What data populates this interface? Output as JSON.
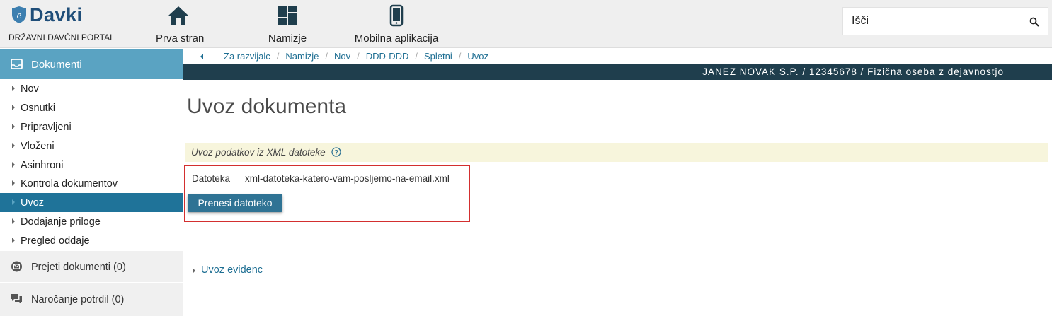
{
  "header": {
    "logo_text": "Davki",
    "logo_subtitle": "DRŽAVNI DAVČNI PORTAL",
    "nav": [
      {
        "label": "Prva stran",
        "icon": "home-icon"
      },
      {
        "label": "Namizje",
        "icon": "dashboard-icon"
      },
      {
        "label": "Mobilna aplikacija",
        "icon": "mobile-phone-icon"
      }
    ],
    "search": {
      "value": "Išči",
      "icon": "search-icon"
    }
  },
  "sidebar": {
    "section_title": "Dokumenti",
    "items": [
      {
        "label": "Nov",
        "active": false
      },
      {
        "label": "Osnutki",
        "active": false
      },
      {
        "label": "Pripravljeni",
        "active": false
      },
      {
        "label": "Vloženi",
        "active": false
      },
      {
        "label": "Asinhroni",
        "active": false
      },
      {
        "label": "Kontrola dokumentov",
        "active": false
      },
      {
        "label": "Uvoz",
        "active": true
      },
      {
        "label": "Dodajanje priloge",
        "active": false
      },
      {
        "label": "Pregled oddaje",
        "active": false
      }
    ],
    "received": "Prejeti dokumenti (0)",
    "orders": "Naročanje potrdil (0)"
  },
  "breadcrumb": [
    "Za razvijalc",
    "Namizje",
    "Nov",
    "DDD-DDD",
    "Spletni",
    "Uvoz"
  ],
  "userbar": "JANEZ NOVAK S.P. / 12345678 / Fizična oseba z dejavnostjo",
  "main": {
    "title": "Uvoz dokumenta",
    "info": "Uvoz podatkov iz XML datoteke",
    "file_label": "Datoteka",
    "file_name": "xml-datoteka-katero-vam-posljemo-na-email.xml",
    "upload_button": "Prenesi datoteko",
    "evidenc_link": "Uvoz evidenc"
  },
  "colors": {
    "sidebar_head": "#5aa3c2",
    "active_item": "#1f7399",
    "userbar": "#1f3e4d",
    "highlight": "#d32f2f",
    "info_bg": "#f7f5dc"
  }
}
